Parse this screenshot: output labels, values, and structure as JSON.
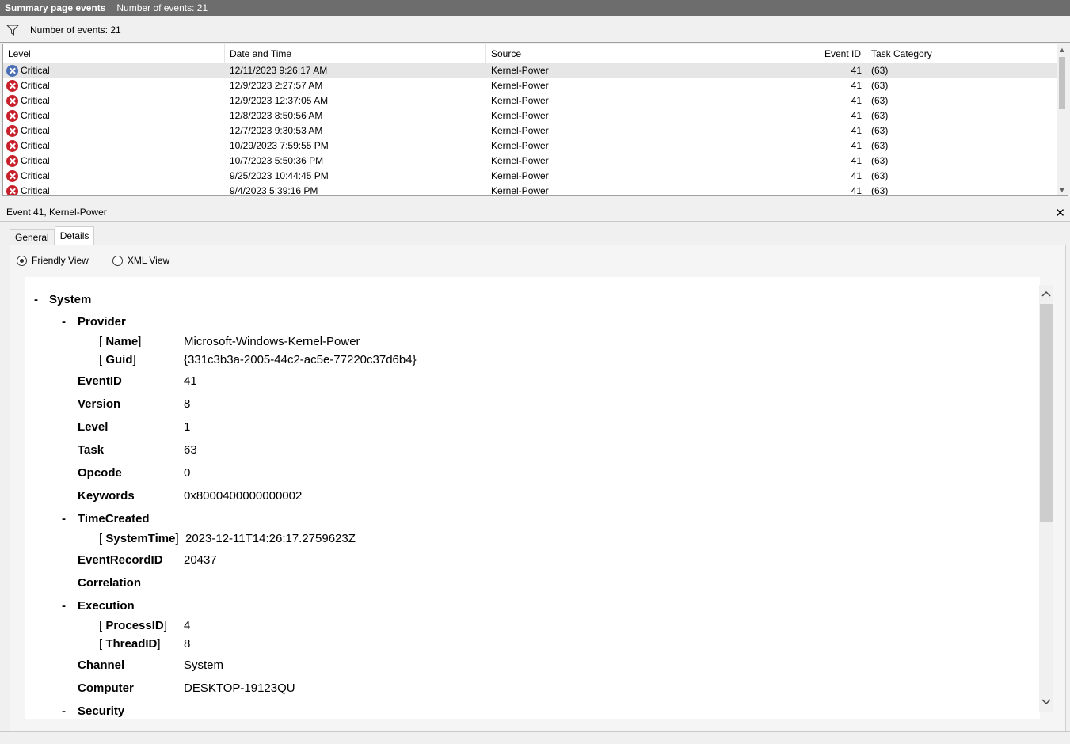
{
  "title": {
    "name": "Summary page events",
    "count": "Number of events: 21"
  },
  "filter": {
    "count": "Number of events: 21"
  },
  "grid": {
    "columns": {
      "level": "Level",
      "date": "Date and Time",
      "source": "Source",
      "event_id": "Event ID",
      "task": "Task Category"
    },
    "rows": [
      {
        "level": "Critical",
        "date": "12/11/2023 9:26:17 AM",
        "source": "Kernel-Power",
        "event_id": "41",
        "task": "(63)"
      },
      {
        "level": "Critical",
        "date": "12/9/2023 2:27:57 AM",
        "source": "Kernel-Power",
        "event_id": "41",
        "task": "(63)"
      },
      {
        "level": "Critical",
        "date": "12/9/2023 12:37:05 AM",
        "source": "Kernel-Power",
        "event_id": "41",
        "task": "(63)"
      },
      {
        "level": "Critical",
        "date": "12/8/2023 8:50:56 AM",
        "source": "Kernel-Power",
        "event_id": "41",
        "task": "(63)"
      },
      {
        "level": "Critical",
        "date": "12/7/2023 9:30:53 AM",
        "source": "Kernel-Power",
        "event_id": "41",
        "task": "(63)"
      },
      {
        "level": "Critical",
        "date": "10/29/2023 7:59:55 PM",
        "source": "Kernel-Power",
        "event_id": "41",
        "task": "(63)"
      },
      {
        "level": "Critical",
        "date": "10/7/2023 5:50:36 PM",
        "source": "Kernel-Power",
        "event_id": "41",
        "task": "(63)"
      },
      {
        "level": "Critical",
        "date": "9/25/2023 10:44:45 PM",
        "source": "Kernel-Power",
        "event_id": "41",
        "task": "(63)"
      },
      {
        "level": "Critical",
        "date": "9/4/2023 5:39:16 PM",
        "source": "Kernel-Power",
        "event_id": "41",
        "task": "(63)"
      }
    ]
  },
  "detail": {
    "header": "Event 41, Kernel-Power",
    "tabs": {
      "general": "General",
      "details": "Details"
    },
    "views": {
      "friendly": "Friendly View",
      "xml": "XML View"
    },
    "tree": {
      "dash": "-",
      "system": "System",
      "provider": "Provider",
      "name_key": "Name",
      "name_val": "Microsoft-Windows-Kernel-Power",
      "guid_key": "Guid",
      "guid_val": "{331c3b3a-2005-44c2-ac5e-77220c37d6b4}",
      "eventid_key": "EventID",
      "eventid_val": "41",
      "version_key": "Version",
      "version_val": "8",
      "level_key": "Level",
      "level_val": "1",
      "task_key": "Task",
      "task_val": "63",
      "opcode_key": "Opcode",
      "opcode_val": "0",
      "keywords_key": "Keywords",
      "keywords_val": "0x8000400000000002",
      "timecreated": "TimeCreated",
      "systemtime_key": "SystemTime",
      "systemtime_val": "2023-12-11T14:26:17.2759623Z",
      "recordid_key": "EventRecordID",
      "recordid_val": "20437",
      "correlation": "Correlation",
      "execution": "Execution",
      "processid_key": "ProcessID",
      "processid_val": "4",
      "threadid_key": "ThreadID",
      "threadid_val": "8",
      "channel_key": "Channel",
      "channel_val": "System",
      "computer_key": "Computer",
      "computer_val": "DESKTOP-19123QU",
      "security": "Security"
    }
  }
}
